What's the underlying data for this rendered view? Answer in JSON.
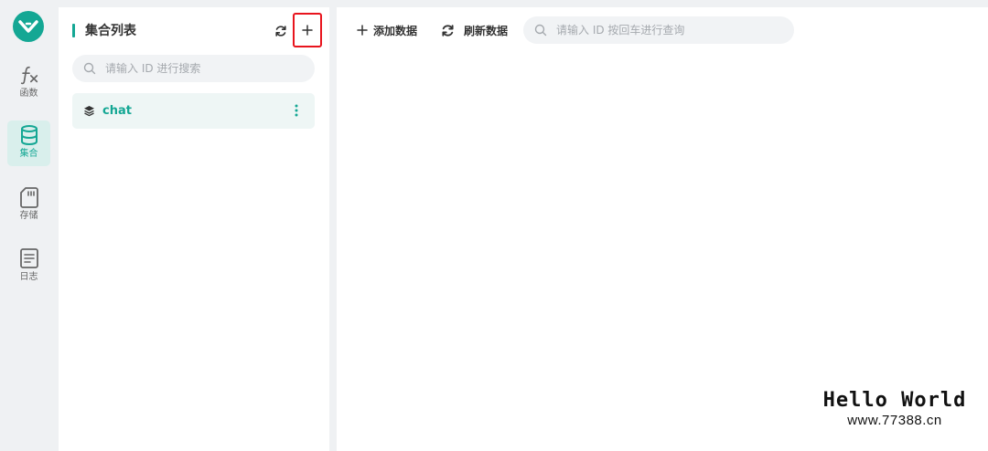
{
  "rail": {
    "items": [
      {
        "label": "函数",
        "icon": "function-icon",
        "active": false
      },
      {
        "label": "集合",
        "icon": "database-icon",
        "active": true
      },
      {
        "label": "存储",
        "icon": "storage-card-icon",
        "active": false
      },
      {
        "label": "日志",
        "icon": "log-document-icon",
        "active": false
      }
    ]
  },
  "collections": {
    "title": "集合列表",
    "search_placeholder": "请输入 ID 进行搜索",
    "items": [
      {
        "name": "chat"
      }
    ]
  },
  "toolbar": {
    "add_label": "添加数据",
    "refresh_label": "刷新数据",
    "search_placeholder": "请输入 ID 按回车进行查询"
  },
  "watermark": {
    "title": "Hello World",
    "url": "www.77388.cn"
  },
  "colors": {
    "accent": "#14a794",
    "highlight_box": "#e8141d"
  }
}
